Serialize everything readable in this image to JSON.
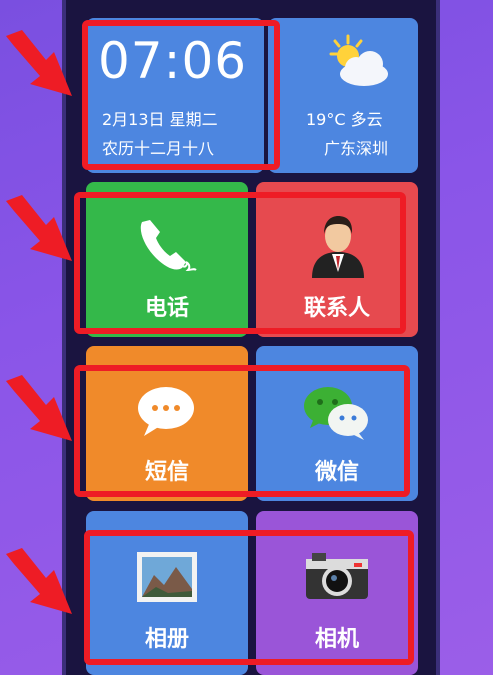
{
  "time_widget": {
    "time": "07:06",
    "date": "2月13日  星期二",
    "lunar": "农历十二月十八"
  },
  "weather_widget": {
    "temp_condition": "19°C  多云",
    "city": "广东深圳",
    "icon": "partly-cloudy-icon"
  },
  "apps": {
    "phone": {
      "label": "电话",
      "icon": "phone-handset-icon"
    },
    "contacts": {
      "label": "联系人",
      "icon": "person-avatar-icon"
    },
    "sms": {
      "label": "短信",
      "icon": "speech-bubble-icon"
    },
    "wechat": {
      "label": "微信",
      "icon": "wechat-icon"
    },
    "photos": {
      "label": "相册",
      "icon": "photo-gallery-icon"
    },
    "camera": {
      "label": "相机",
      "icon": "camera-icon"
    }
  },
  "colors": {
    "highlight": "#ee1c25",
    "tile_blue": "#4d86e0",
    "tile_green": "#34b84a",
    "tile_red": "#e64a4f",
    "tile_orange": "#f08a2a",
    "tile_purple": "#9a55d8"
  }
}
